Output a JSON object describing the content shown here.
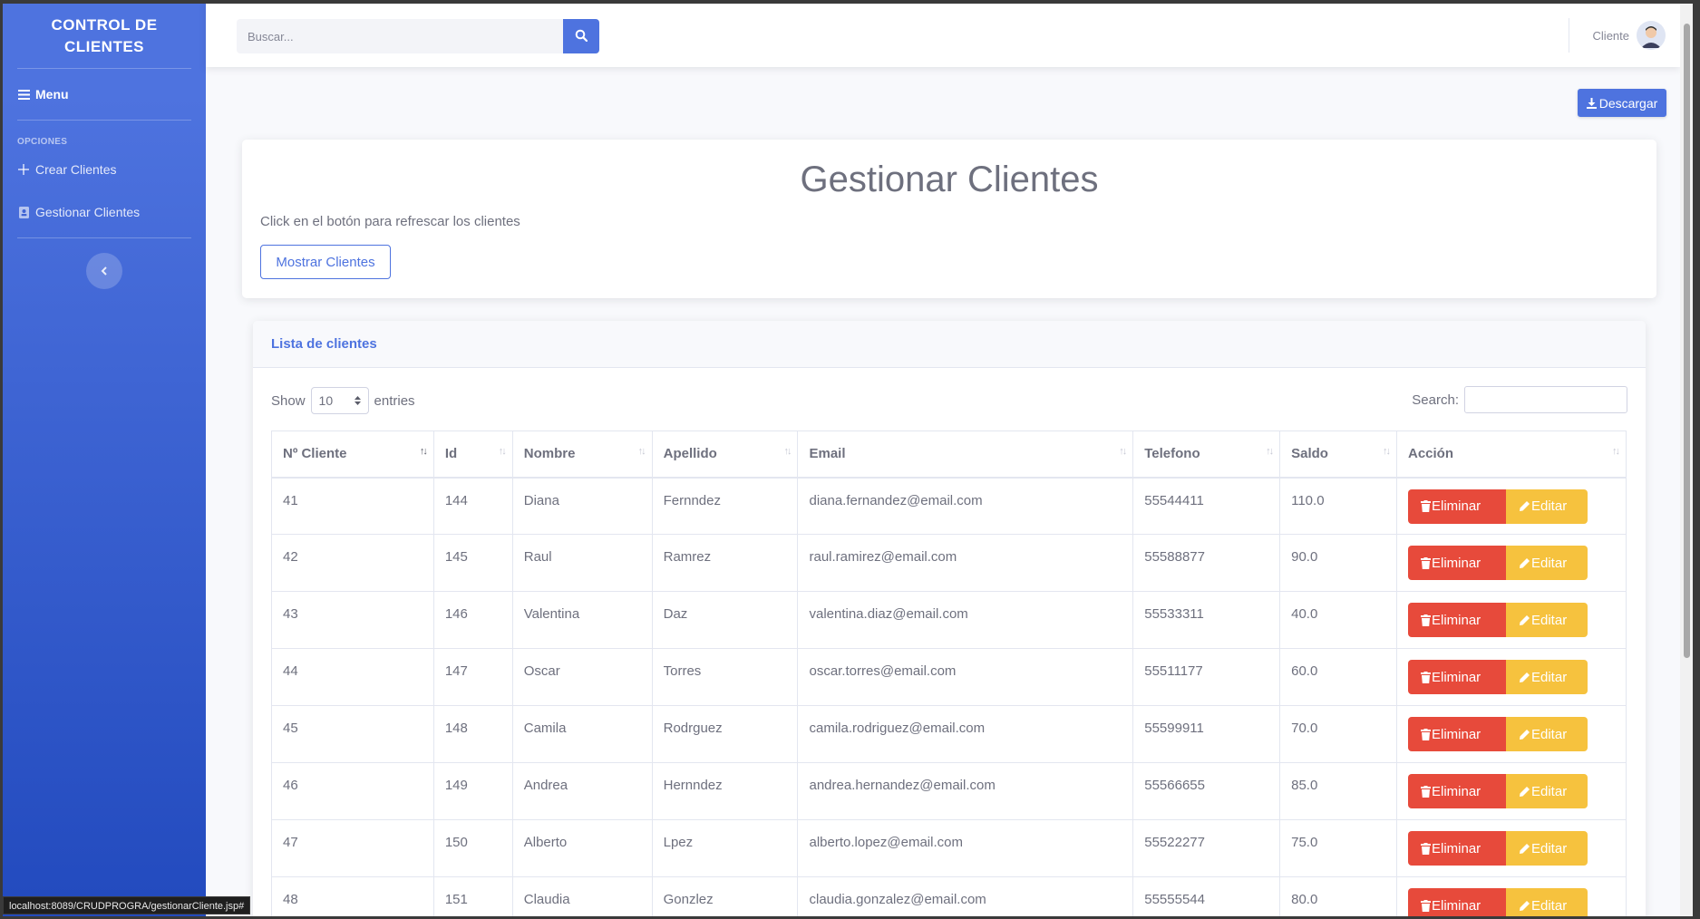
{
  "sidebar": {
    "brand": "CONTROL DE\nCLIENTES",
    "menu_label": "Menu",
    "heading": "OPCIONES",
    "items": [
      {
        "label": "Crear Clientes",
        "icon": "plus-icon"
      },
      {
        "label": "Gestionar Clientes",
        "icon": "address-book-icon"
      }
    ],
    "toggle_icon": "chevron-left-icon"
  },
  "topbar": {
    "search_placeholder": "Buscar...",
    "user_name": "Cliente"
  },
  "main": {
    "download_label": "Descargar",
    "title": "Gestionar Clientes",
    "description": "Click en el botón para refrescar los clientes",
    "show_button": "Mostrar Clientes"
  },
  "list": {
    "header": "Lista de clientes",
    "show_label": "Show",
    "entries_value": "10",
    "entries_label": "entries",
    "search_label": "Search:",
    "columns": [
      "Nº Cliente",
      "Id",
      "Nombre",
      "Apellido",
      "Email",
      "Telefono",
      "Saldo",
      "Acción"
    ],
    "delete_label": "Eliminar",
    "edit_label": "Editar",
    "rows": [
      [
        "41",
        "144",
        "Diana",
        "Fernndez",
        "diana.fernandez@email.com",
        "55544411",
        "110.0"
      ],
      [
        "42",
        "145",
        "Raul",
        "Ramrez",
        "raul.ramirez@email.com",
        "55588877",
        "90.0"
      ],
      [
        "43",
        "146",
        "Valentina",
        "Daz",
        "valentina.diaz@email.com",
        "55533311",
        "40.0"
      ],
      [
        "44",
        "147",
        "Oscar",
        "Torres",
        "oscar.torres@email.com",
        "55511177",
        "60.0"
      ],
      [
        "45",
        "148",
        "Camila",
        "Rodrguez",
        "camila.rodriguez@email.com",
        "55599911",
        "70.0"
      ],
      [
        "46",
        "149",
        "Andrea",
        "Hernndez",
        "andrea.hernandez@email.com",
        "55566655",
        "85.0"
      ],
      [
        "47",
        "150",
        "Alberto",
        "Lpez",
        "alberto.lopez@email.com",
        "55522277",
        "75.0"
      ],
      [
        "48",
        "151",
        "Claudia",
        "Gonzlez",
        "claudia.gonzalez@email.com",
        "55555544",
        "80.0"
      ]
    ]
  },
  "status_url": "localhost:8089/CRUDPROGRA/gestionarCliente.jsp#",
  "colors": {
    "primary": "#4e73df",
    "danger": "#e74a3b",
    "warning": "#f6c23e"
  }
}
